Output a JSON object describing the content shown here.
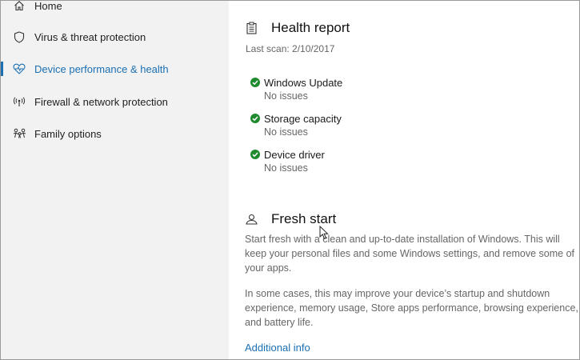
{
  "sidebar": {
    "items": [
      {
        "label": "Home",
        "icon": "home-icon"
      },
      {
        "label": "Virus & threat protection",
        "icon": "shield-icon"
      },
      {
        "label": "Device performance & health",
        "icon": "heart-pulse-icon",
        "active": true
      },
      {
        "label": "Firewall & network protection",
        "icon": "antenna-icon"
      },
      {
        "label": "Family options",
        "icon": "family-icon"
      }
    ]
  },
  "health_report": {
    "title": "Health report",
    "last_scan": "Last scan: 2/10/2017",
    "items": [
      {
        "name": "Windows Update",
        "status": "No issues"
      },
      {
        "name": "Storage capacity",
        "status": "No issues"
      },
      {
        "name": "Device driver",
        "status": "No issues"
      }
    ]
  },
  "fresh_start": {
    "title": "Fresh start",
    "paragraph1": "Start fresh with a clean and up-to-date installation of Windows. This will keep your personal files and some Windows settings, and remove some of your apps.",
    "paragraph2": "In some cases, this may improve your device’s startup and shutdown experience, memory usage, Store apps performance, browsing experience, and battery life.",
    "link": "Additional info"
  },
  "colors": {
    "accent": "#1b6fb3",
    "check": "#1f8a2e",
    "sidebar_bg": "#f2f2f2"
  }
}
